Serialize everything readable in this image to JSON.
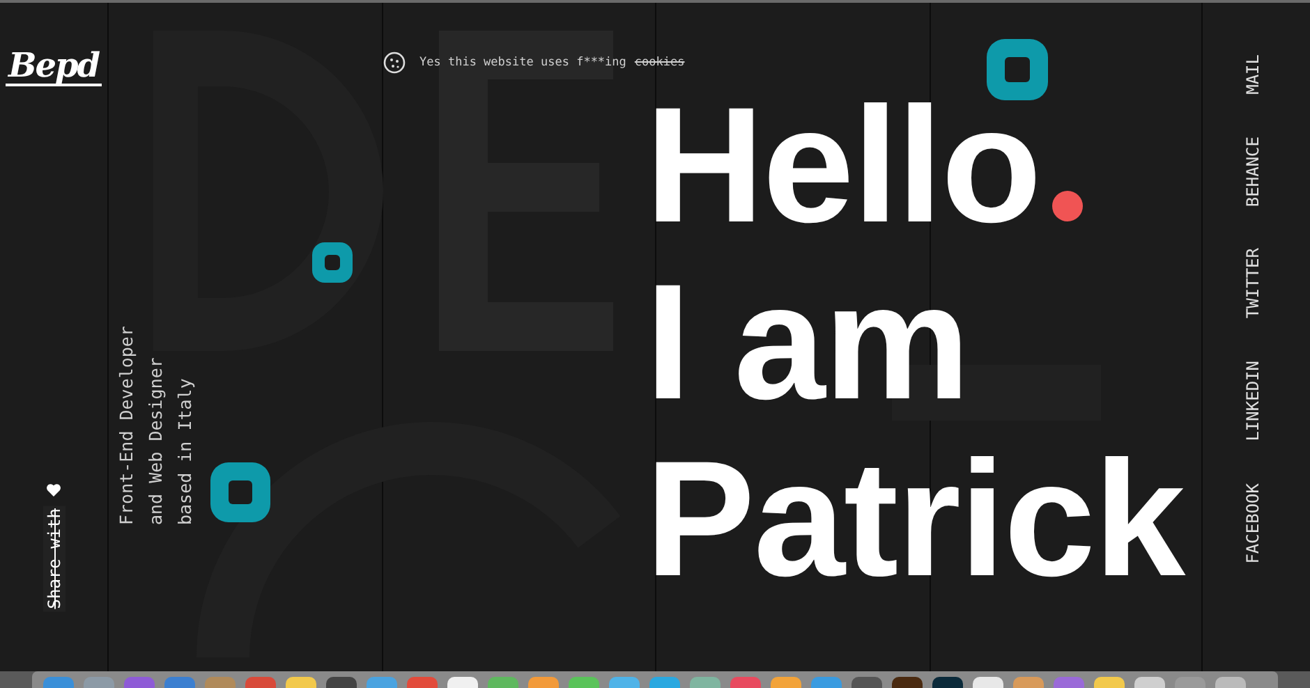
{
  "logo": {
    "text": "Bepd"
  },
  "cookie_notice": {
    "text": "Yes this website uses f***ing",
    "link": "cookies"
  },
  "hello": [
    "Hello",
    "I am",
    "Patrick"
  ],
  "tagline": "Front-End Developer\nand Web Designer\nbased in Italy",
  "share": {
    "label": "Share with"
  },
  "social_links": [
    "MAIL",
    "BEHANCE",
    "TWITTER",
    "LINKEDIN",
    "FACEBOOK"
  ]
}
